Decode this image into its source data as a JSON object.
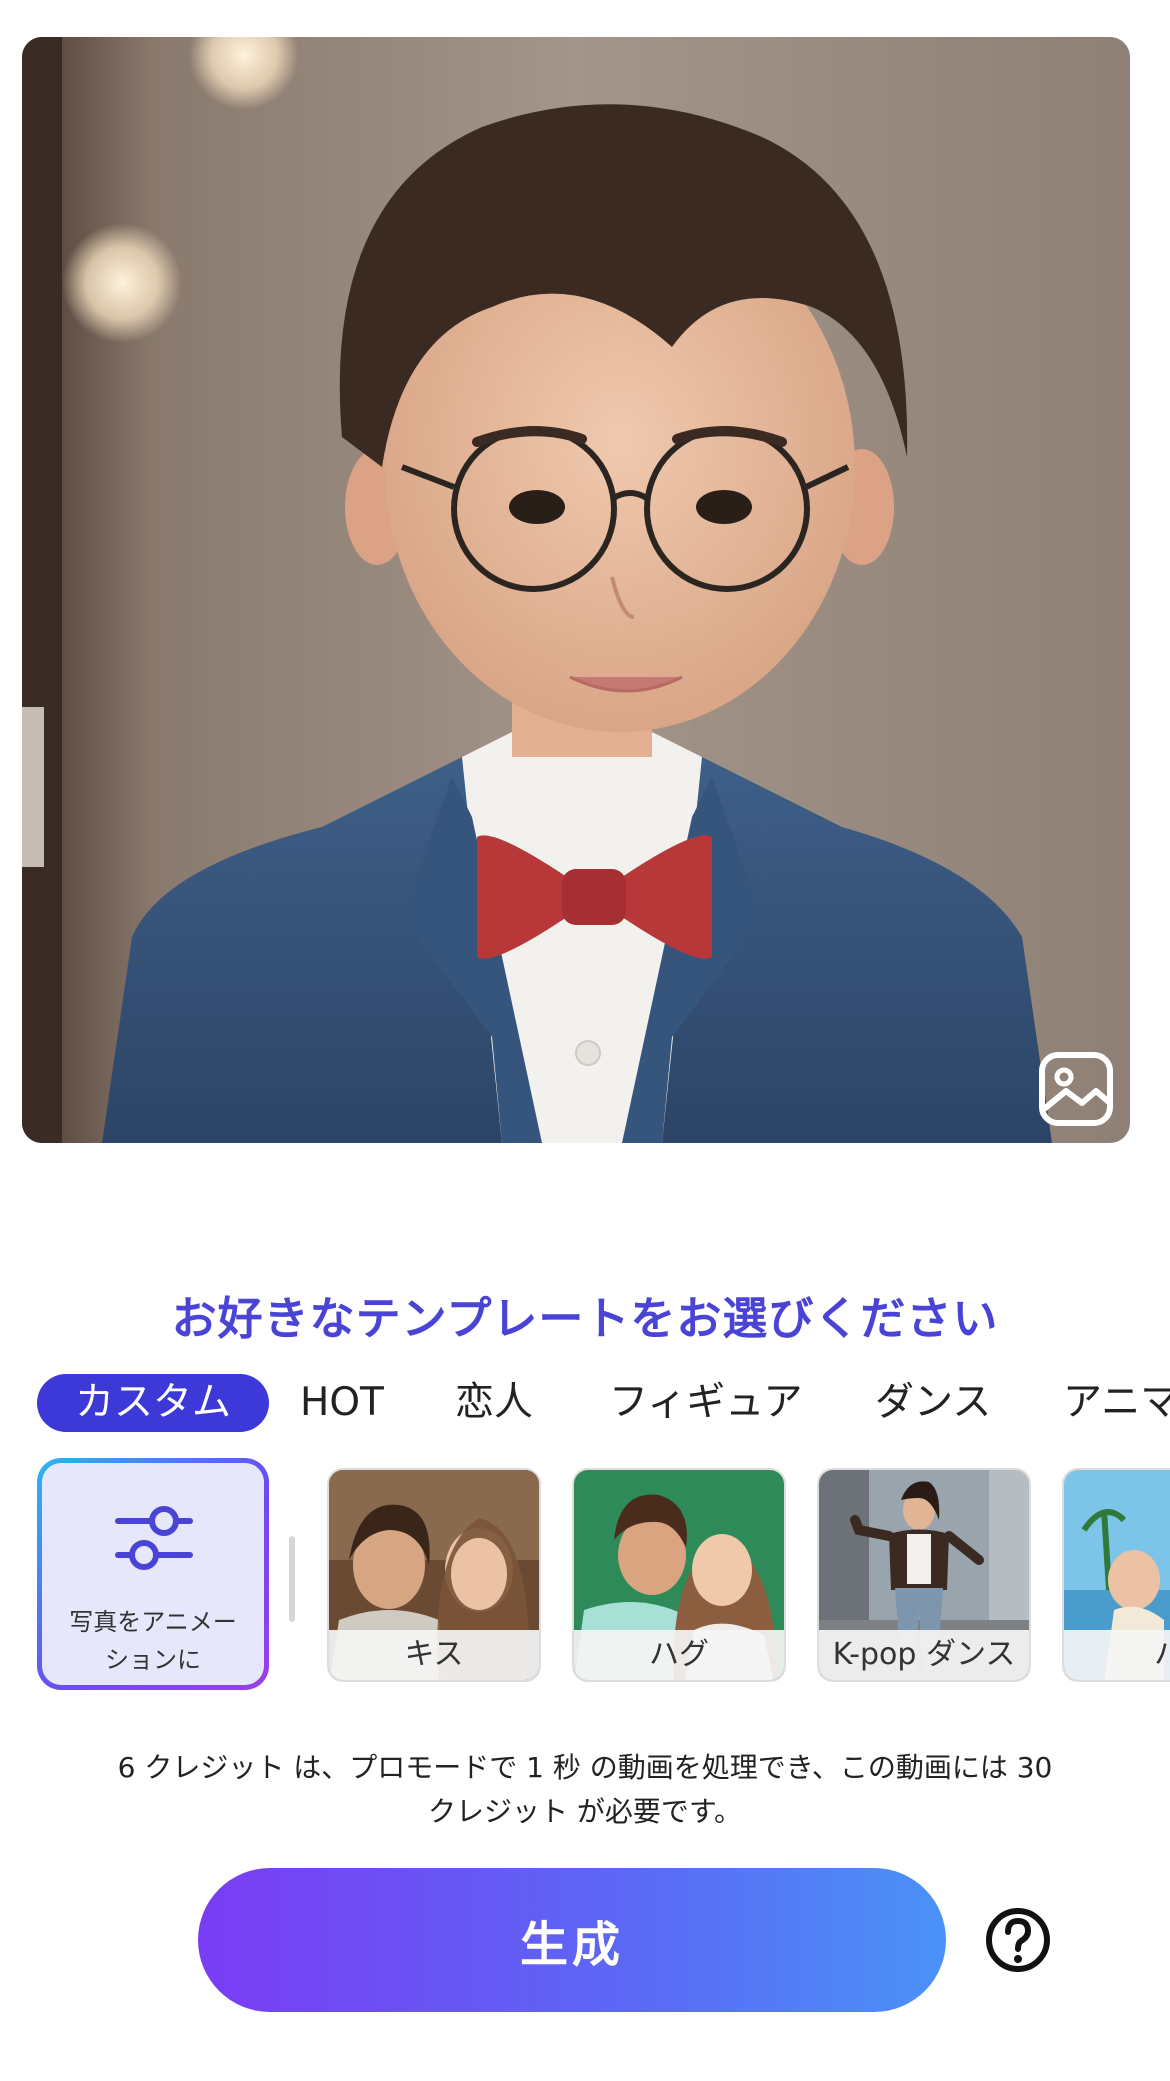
{
  "prompt": {
    "title": "お好きなテンプレートをお選びください"
  },
  "tabs": [
    {
      "label": "カスタム",
      "active": true
    },
    {
      "label": "HOT",
      "active": false
    },
    {
      "label": "恋人",
      "active": false
    },
    {
      "label": "フィギュア",
      "active": false
    },
    {
      "label": "ダンス",
      "active": false
    },
    {
      "label": "アニマ",
      "active": false
    }
  ],
  "custom_card": {
    "label_line1": "写真をアニメー",
    "label_line2": "ションに",
    "icon": "sliders-icon"
  },
  "templates": [
    {
      "caption": "キス"
    },
    {
      "caption": "ハグ"
    },
    {
      "caption": "K-pop ダンス"
    },
    {
      "caption": "ハ"
    }
  ],
  "credits": {
    "line1": "6 クレジット は、プロモードで 1 秒 の動画を処理でき、この動画には 30",
    "line2": "クレジット が必要です。"
  },
  "actions": {
    "generate_label": "生成",
    "help_icon": "question-circle-icon",
    "gallery_icon": "image-icon"
  },
  "colors": {
    "accent": "#3d39d9",
    "gradient_start": "#7a3cf4",
    "gradient_end": "#4a92f7"
  }
}
